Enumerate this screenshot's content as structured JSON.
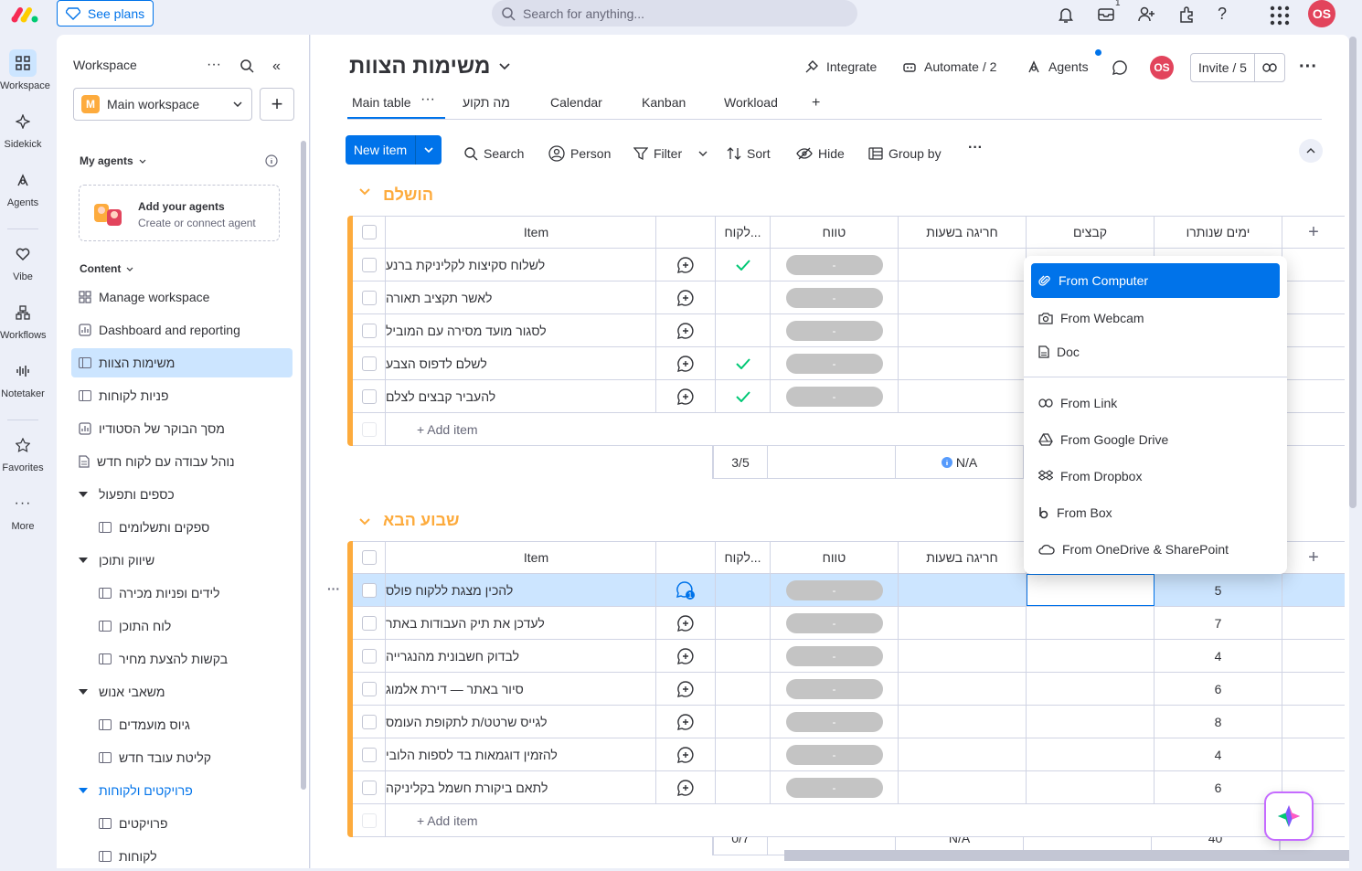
{
  "topbar": {
    "see_plans": "See plans",
    "search_placeholder": "Search for anything...",
    "inbox_badge": "1",
    "user_initials": "OS"
  },
  "rail": [
    {
      "label": "Workspace"
    },
    {
      "label": "Sidekick"
    },
    {
      "label": "Agents"
    },
    {
      "label": "Vibe"
    },
    {
      "label": "Workflows"
    },
    {
      "label": "Notetaker"
    },
    {
      "label": "Favorites"
    },
    {
      "label": "More"
    }
  ],
  "sidebar": {
    "title": "Workspace",
    "workspace_name": "Main workspace",
    "workspace_initial": "M",
    "my_agents_label": "My agents",
    "add_agents_title": "Add your agents",
    "add_agents_sub": "Create or connect agent",
    "content_label": "Content",
    "items": [
      {
        "label": "Manage workspace"
      },
      {
        "label": "Dashboard and reporting"
      },
      {
        "label": "משימות הצוות"
      },
      {
        "label": "פניות לקוחות"
      },
      {
        "label": "מסך הבוקר של הסטודיו"
      },
      {
        "label": "נוהל עבודה עם לקוח חדש"
      },
      {
        "label": "כספים ותפעול"
      },
      {
        "label": "ספקים ותשלומים"
      },
      {
        "label": "שיווק ותוכן"
      },
      {
        "label": "לידים ופניות מכירה"
      },
      {
        "label": "לוח התוכן"
      },
      {
        "label": "בקשות להצעת מחיר"
      },
      {
        "label": "משאבי אנוש"
      },
      {
        "label": "גיוס מועמדים"
      },
      {
        "label": "קליטת עובד חדש"
      },
      {
        "label": "פרויקטים ולקוחות"
      },
      {
        "label": "פרויקטים"
      },
      {
        "label": "לקוחות"
      }
    ]
  },
  "board": {
    "title": "משימות הצוות",
    "actions": {
      "integrate": "Integrate",
      "automate": "Automate / 2",
      "agents": "Agents",
      "invite": "Invite / 5",
      "avatar": "OS"
    },
    "tabs": [
      "Main table",
      "מה תקוע",
      "Calendar",
      "Kanban",
      "Workload",
      "+"
    ],
    "toolbar": {
      "new_item": "New item",
      "search": "Search",
      "person": "Person",
      "filter": "Filter",
      "sort": "Sort",
      "hide": "Hide",
      "group_by": "Group by"
    }
  },
  "columns": {
    "item": "Item",
    "client": "לקוח...",
    "timeline": "טווח",
    "overrun": "חריגה בשעות",
    "files": "קבצים",
    "days": "ימים שנותרו"
  },
  "groups": [
    {
      "title": "הושלם",
      "rows": [
        {
          "name": "לשלוח סקיצות לקליניקת ברנע",
          "check": true,
          "tl": "-"
        },
        {
          "name": "לאשר תקציב תאורה",
          "check": false,
          "tl": "-"
        },
        {
          "name": "לסגור מועד מסירה עם המוביל",
          "check": false,
          "tl": "-"
        },
        {
          "name": "לשלם לדפוס הצבע",
          "check": true,
          "tl": "-"
        },
        {
          "name": "להעביר קבצים לצלם",
          "check": true,
          "tl": "-"
        }
      ],
      "add_item": "+ Add item",
      "summary": {
        "client": "3/5",
        "overrun": "N/A"
      }
    },
    {
      "title": "שבוע הבא",
      "rows": [
        {
          "name": "להכין מצגת ללקוח פולס",
          "tl": "-",
          "days": "5"
        },
        {
          "name": "לעדכן את תיק העבודות באתר",
          "tl": "-",
          "days": "7"
        },
        {
          "name": "לבדוק חשבונית מהנגרייה",
          "tl": "-",
          "days": "4"
        },
        {
          "name": "סיור באתר — דירת אלמוג",
          "tl": "-",
          "days": "6"
        },
        {
          "name": "לגייס שרטט/ת לתקופת העומס",
          "tl": "-",
          "days": "8"
        },
        {
          "name": "להזמין דוגמאות בד לספות הלובי",
          "tl": "-",
          "days": "4"
        },
        {
          "name": "לתאם ביקורת חשמל בקליניקה",
          "tl": "-",
          "days": "6"
        }
      ],
      "add_item": "+ Add item",
      "summary": {
        "client": "0/7",
        "overrun": "N/A",
        "days": "40"
      }
    }
  ],
  "file_menu": {
    "items": [
      {
        "label": "From Computer",
        "icon": "paperclip-icon"
      },
      {
        "label": "From Webcam",
        "icon": "camera-icon"
      },
      {
        "label": "Doc",
        "icon": "doc-icon"
      },
      {
        "label": "From Link",
        "icon": "link-icon"
      },
      {
        "label": "From Google Drive",
        "icon": "google-drive-icon"
      },
      {
        "label": "From Dropbox",
        "icon": "dropbox-icon"
      },
      {
        "label": "From Box",
        "icon": "box-icon"
      },
      {
        "label": "From OneDrive & SharePoint",
        "icon": "onedrive-icon"
      }
    ]
  },
  "colors": {
    "accent": "#0073ea",
    "group": "#fdab3d",
    "done": "#00c875",
    "avatar": "#e2445c"
  }
}
